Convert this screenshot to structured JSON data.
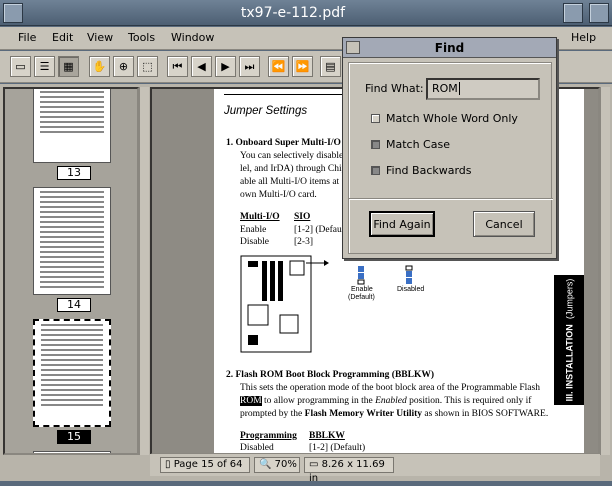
{
  "window": {
    "title": "tx97-e-112.pdf"
  },
  "menu": {
    "file": "File",
    "edit": "Edit",
    "view": "View",
    "tools": "Tools",
    "window": "Window",
    "help": "Help"
  },
  "thumbnails": {
    "labels": [
      "13",
      "14",
      "15"
    ]
  },
  "page": {
    "heading": "Jumper Settings",
    "item1_title": "1.   Onboard Super Multi-I/O S",
    "item1_lines": [
      "You can selectively disable e",
      "lel, and IrDA) through Chips",
      "able all Multi-I/O items at on",
      "own Multi-I/O card."
    ],
    "table_h1": "Multi-I/O",
    "table_h2": "SIO",
    "row1_a": "Enable",
    "row1_b": "[1-2]  (Default",
    "row2_a": "Disable",
    "row2_b": "[2-3]",
    "jumper_enable": "Enable",
    "jumper_default": "(Default)",
    "jumper_disabled": "Disabled",
    "item2_title": "2.   Flash ROM Boot Block Programming (BBLKW)",
    "item2_l1": "This sets the operation mode of the boot block area of the Programmable Flash",
    "item2_l2_hl": "ROM",
    "item2_l2_a": " to allow programming in the ",
    "item2_l2_em": "Enabled",
    "item2_l2_b": " position.  This is required only if",
    "item2_l3_a": "prompted by the ",
    "item2_l3_b": "Flash Memory Writer Utility",
    "item2_l3_c": " as shown in BIOS SOFTWARE.",
    "table2_h1": "Programming",
    "table2_h2": "BBLKW",
    "table2_r1_a": "Disabled",
    "table2_r1_b": "[1-2]  (Default)",
    "sidetab_main": "III. INSTALLATION",
    "sidetab_sub": "(Jumpers)"
  },
  "status": {
    "page": "Page 15 of 64",
    "zoom": "70%",
    "size": "8.26 x 11.69 in"
  },
  "find_dialog": {
    "title": "Find",
    "find_what_label": "Find What:",
    "find_what_value": "ROM",
    "match_whole_word": "Match Whole Word Only",
    "match_case": "Match Case",
    "find_backwards": "Find Backwards",
    "find_again": "Find Again",
    "cancel": "Cancel",
    "match_whole_word_checked": false,
    "match_case_checked": true,
    "find_backwards_checked": true
  }
}
